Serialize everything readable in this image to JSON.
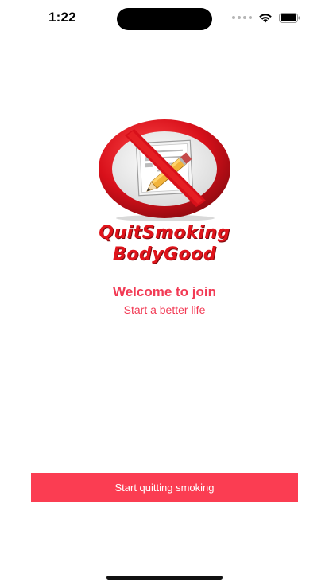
{
  "status_bar": {
    "time": "1:22",
    "icons": [
      "signal-icon",
      "wifi-icon",
      "battery-icon"
    ]
  },
  "brand": {
    "line1": "QuitSmoking",
    "line2": "BodyGood",
    "logo_icon": "no-smoking-sign-icon",
    "color": "#e0141b"
  },
  "welcome": {
    "title": "Welcome to join",
    "subtitle": "Start a better life",
    "color": "#f23b55"
  },
  "actions": {
    "start_label": "Start quitting smoking",
    "color": "#fb3d52"
  }
}
